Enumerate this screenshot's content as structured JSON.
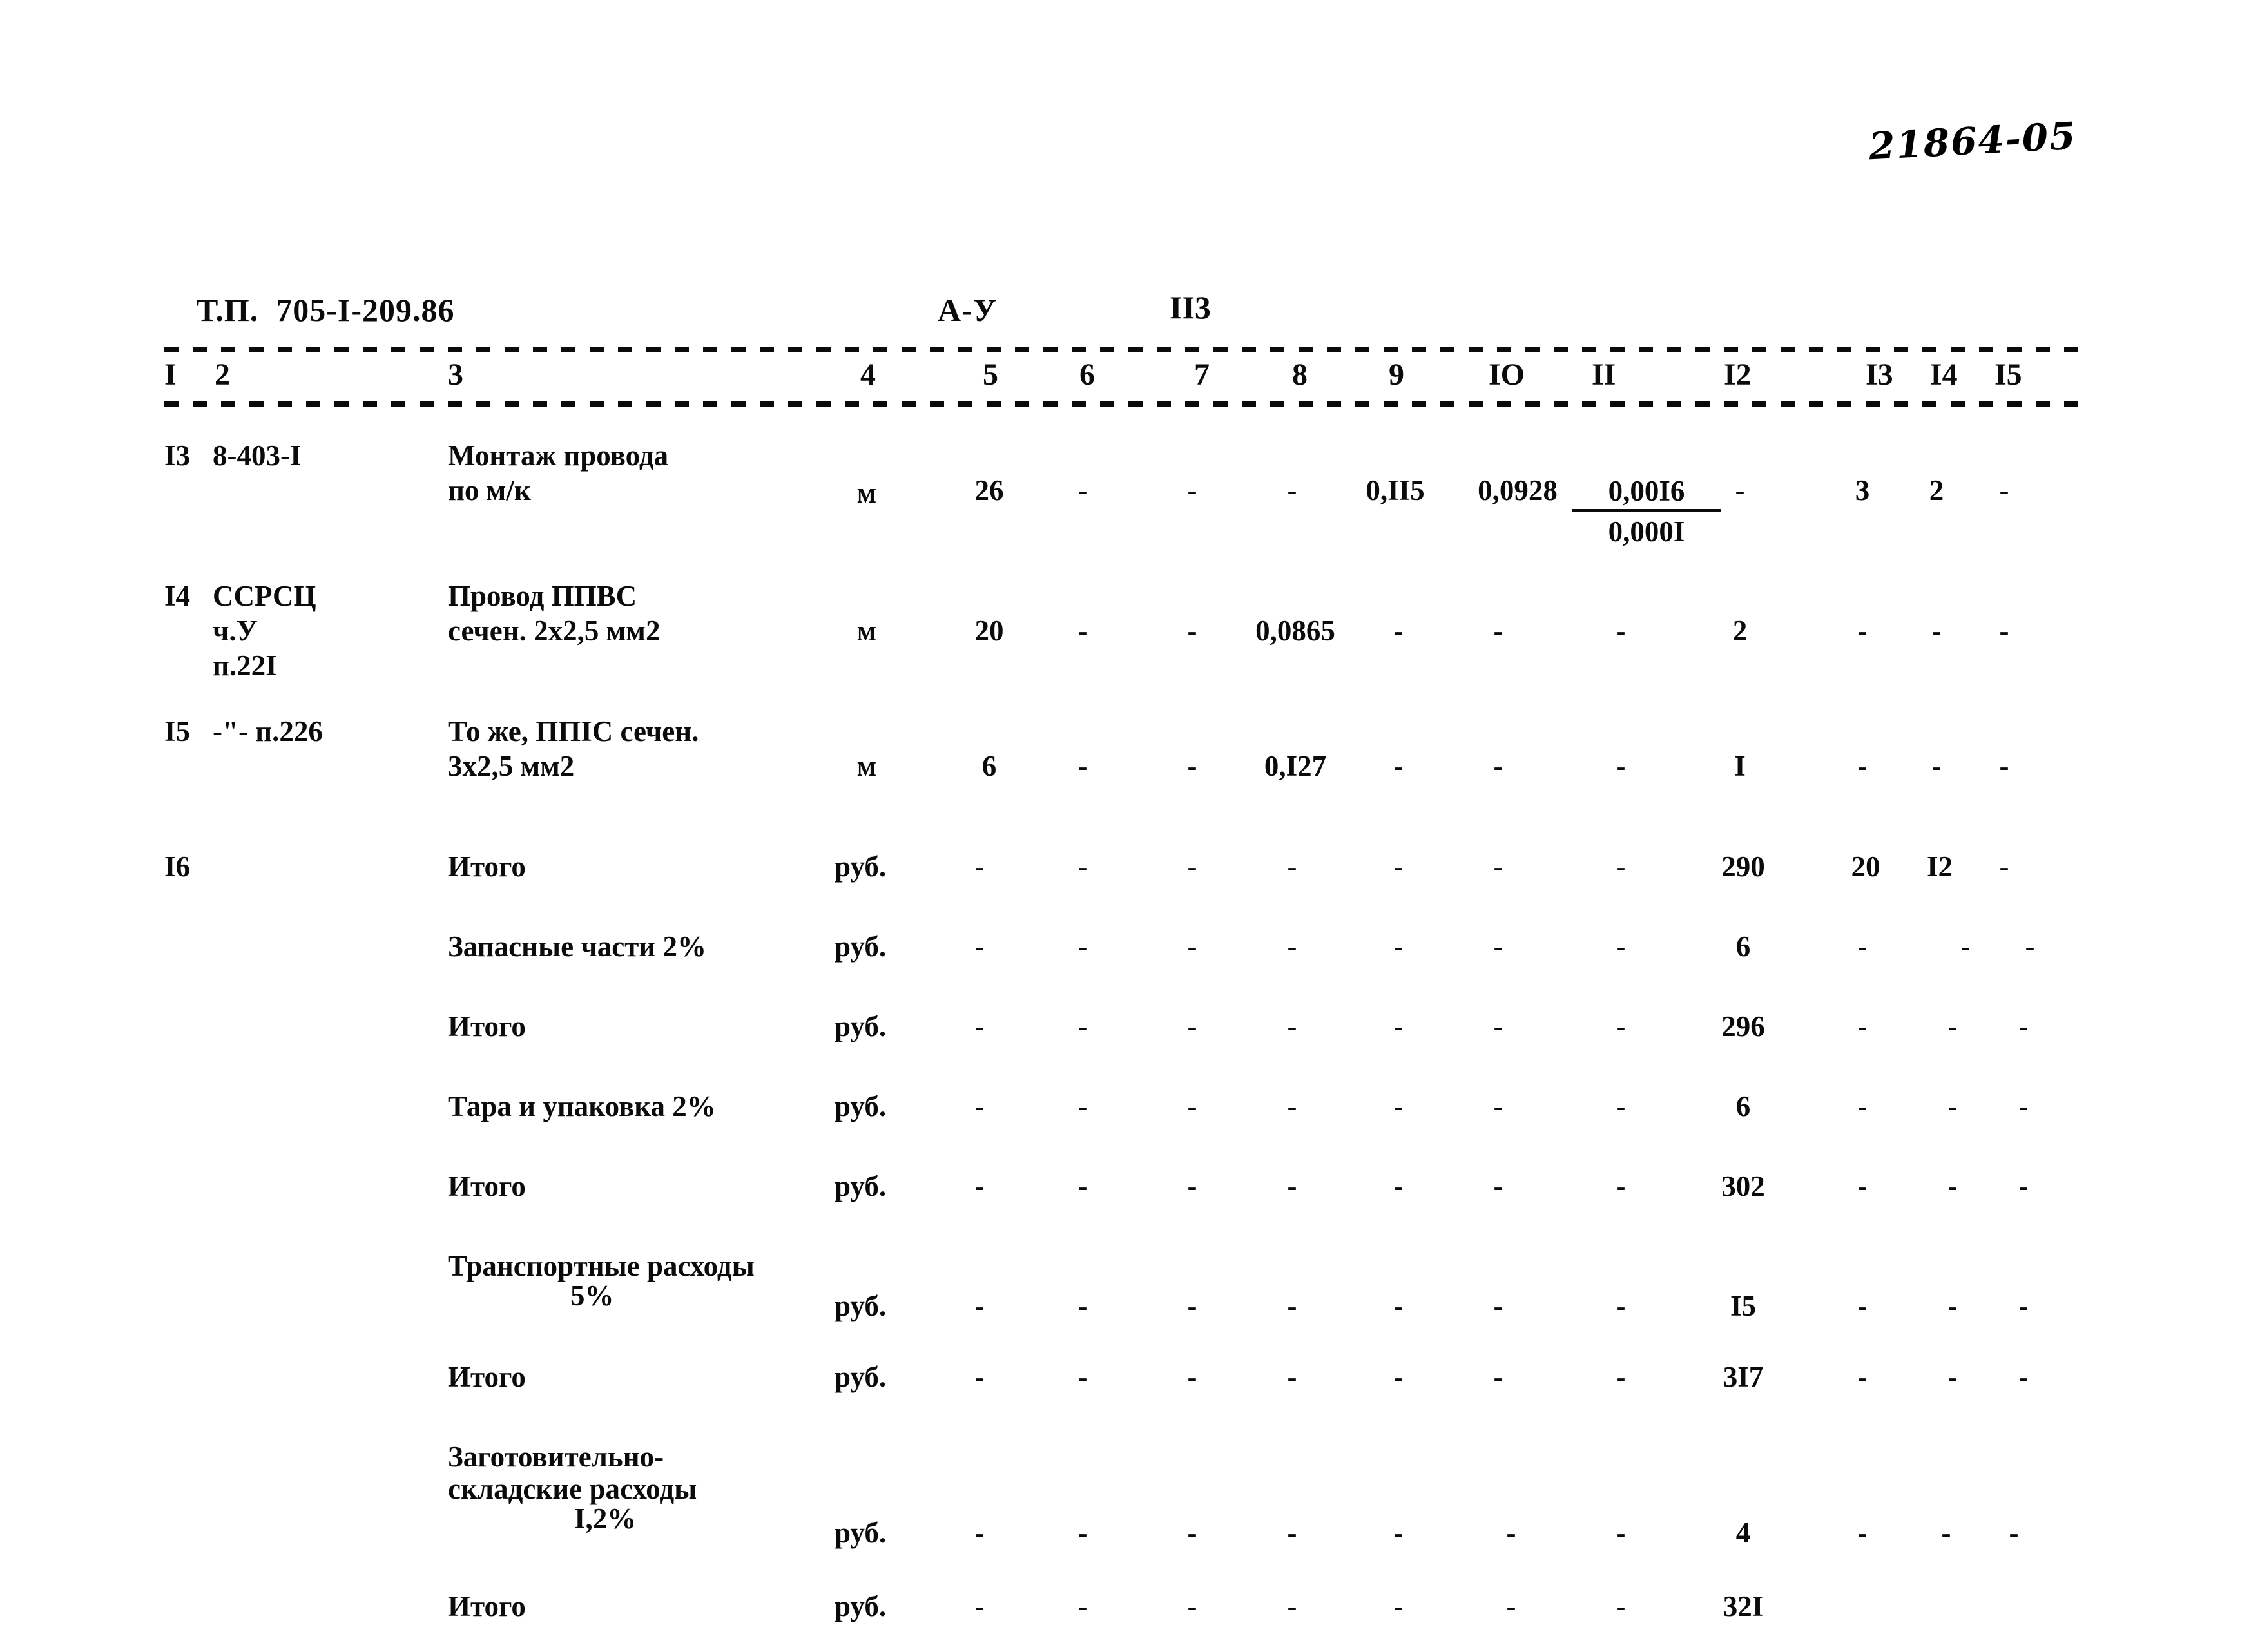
{
  "archive_number": "21864-05",
  "header": {
    "document_code": "Т.П.  705-I-209.86",
    "series": "А-У",
    "sheet_number": "II3"
  },
  "column_numbers": [
    "I",
    "2",
    "3",
    "4",
    "5",
    "6",
    "7",
    "8",
    "9",
    "IO",
    "II",
    "I2",
    "I3",
    "I4",
    "I5"
  ],
  "rows": [
    {
      "id": "row-13",
      "c1": "I3",
      "c2": "8-403-I",
      "c3_line1": "Монтаж провода",
      "c3_line2": "по м/к",
      "c4": "м",
      "c5": "26",
      "c6": "-",
      "c7": "-",
      "c8": "-",
      "c9": "0,II5",
      "c10": "0,0928",
      "c11_num": "0,00I6",
      "c11_den": "0,000I",
      "c12": "-",
      "c13": "3",
      "c14": "2",
      "c15": "-"
    },
    {
      "id": "row-14",
      "c1": "I4",
      "c2_line1": "ССРСЦ",
      "c2_line2": "ч.У",
      "c2_line3": "п.22I",
      "c3_line1": "Провод ППВС",
      "c3_line2": "сечен. 2х2,5 мм2",
      "c4": "м",
      "c5": "20",
      "c6": "-",
      "c7": "-",
      "c8": "0,0865",
      "c9": "-",
      "c10": "-",
      "c11": "-",
      "c12": "2",
      "c13": "-",
      "c14": "-",
      "c15": "-"
    },
    {
      "id": "row-15",
      "c1": "I5",
      "c2": "-\"- п.226",
      "c3_line1": "То же, ППIС сечен.",
      "c3_line2": "3х2,5 мм2",
      "c4": "м",
      "c5": "6",
      "c6": "-",
      "c7": "-",
      "c8": "0,I27",
      "c9": "-",
      "c10": "-",
      "c11": "-",
      "c12": "I",
      "c13": "-",
      "c14": "-",
      "c15": "-"
    }
  ],
  "totals": {
    "row_number": "I6",
    "lines": [
      {
        "id": "total-itogo-1",
        "label": "Итого",
        "unit": "руб.",
        "c5": "-",
        "c6": "-",
        "c7": "-",
        "c8": "-",
        "c9": "-",
        "c10": "-",
        "c11": "-",
        "c12": "290",
        "c13": "20",
        "c14": "I2",
        "c15": "-"
      },
      {
        "id": "total-spare-parts",
        "label": "Запасные части 2%",
        "unit": "руб.",
        "c5": "-",
        "c6": "-",
        "c7": "-",
        "c8": "-",
        "c9": "-",
        "c10": "-",
        "c11": "-",
        "c12": "6",
        "c13": "-",
        "c14": "-",
        "c15": "-"
      },
      {
        "id": "total-itogo-2",
        "label": "Итого",
        "unit": "руб.",
        "c5": "-",
        "c6": "-",
        "c7": "-",
        "c8": "-",
        "c9": "-",
        "c10": "-",
        "c11": "-",
        "c12": "296",
        "c13": "-",
        "c14": "-",
        "c15": "-"
      },
      {
        "id": "total-packaging",
        "label": "Тара и упаковка 2%",
        "unit": "руб.",
        "c5": "-",
        "c6": "-",
        "c7": "-",
        "c8": "-",
        "c9": "-",
        "c10": "-",
        "c11": "-",
        "c12": "6",
        "c13": "-",
        "c14": "-",
        "c15": "-"
      },
      {
        "id": "total-itogo-3",
        "label": "Итого",
        "unit": "руб.",
        "c5": "-",
        "c6": "-",
        "c7": "-",
        "c8": "-",
        "c9": "-",
        "c10": "-",
        "c11": "-",
        "c12": "302",
        "c13": "-",
        "c14": "-",
        "c15": "-"
      },
      {
        "id": "total-transport",
        "label_line1": "Транспортные расходы",
        "label_line2": "5%",
        "unit": "руб.",
        "c5": "-",
        "c6": "-",
        "c7": "-",
        "c8": "-",
        "c9": "-",
        "c10": "-",
        "c11": "-",
        "c12": "I5",
        "c13": "-",
        "c14": "-",
        "c15": "-"
      },
      {
        "id": "total-itogo-4",
        "label": "Итого",
        "unit": "руб.",
        "c5": "-",
        "c6": "-",
        "c7": "-",
        "c8": "-",
        "c9": "-",
        "c10": "-",
        "c11": "-",
        "c12": "3I7",
        "c13": "-",
        "c14": "-",
        "c15": "-"
      },
      {
        "id": "total-procurement",
        "label_line1": "Заготовительно-",
        "label_line2": "складские расходы",
        "label_line3": "I,2%",
        "unit": "руб.",
        "c5": "-",
        "c6": "-",
        "c7": "-",
        "c8": "-",
        "c9": "-",
        "c10": "-",
        "c11": "-",
        "c12": "4",
        "c13": "-",
        "c14": "-",
        "c15": "-"
      },
      {
        "id": "total-itogo-5",
        "label": "Итого",
        "unit": "руб.",
        "c5": "-",
        "c6": "-",
        "c7": "-",
        "c8": "-",
        "c9": "-",
        "c10": "-",
        "c11": "-",
        "c12": "32I",
        "c13": "",
        "c14": "",
        "c15": ""
      }
    ]
  }
}
